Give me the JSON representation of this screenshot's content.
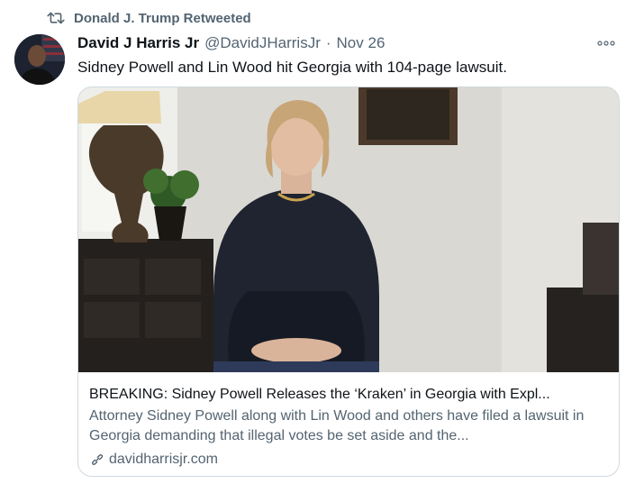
{
  "retweet": {
    "icon": "retweet-icon",
    "label": "Donald J. Trump Retweeted"
  },
  "tweet": {
    "author_name": "David J Harris Jr",
    "author_handle": "@DavidJHarrisJr",
    "separator": "·",
    "date": "Nov 26",
    "text": "Sidney Powell and Lin Wood hit Georgia with 104-page lawsuit.",
    "more_icon": "more-icon"
  },
  "card": {
    "title": "BREAKING: Sidney Powell Releases the ‘Kraken’ in Georgia with Expl...",
    "description": "Attorney Sidney Powell along with Lin Wood and others have filed a lawsuit in Georgia demanding that illegal votes be set aside and the...",
    "domain": "davidharrisjr.com",
    "link_icon": "link-icon"
  },
  "colors": {
    "text": "#0f1419",
    "secondary": "#536471",
    "border": "#cfd9de"
  }
}
